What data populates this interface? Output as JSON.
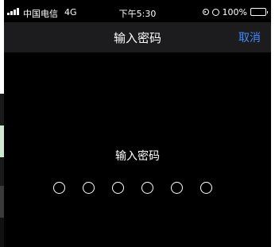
{
  "status_bar": {
    "carrier": "中国电信",
    "network": "4G",
    "time": "下午5:30",
    "battery_percent": "100%",
    "battery_level": 1.0
  },
  "nav": {
    "title": "输入密码",
    "cancel_label": "取消"
  },
  "prompt": "输入密码",
  "passcode": {
    "length": 6,
    "entered": 0
  },
  "colors": {
    "accent": "#3e8dff",
    "background": "#000000",
    "nav_background": "#1c1c1e",
    "battery": "#4cd964"
  }
}
